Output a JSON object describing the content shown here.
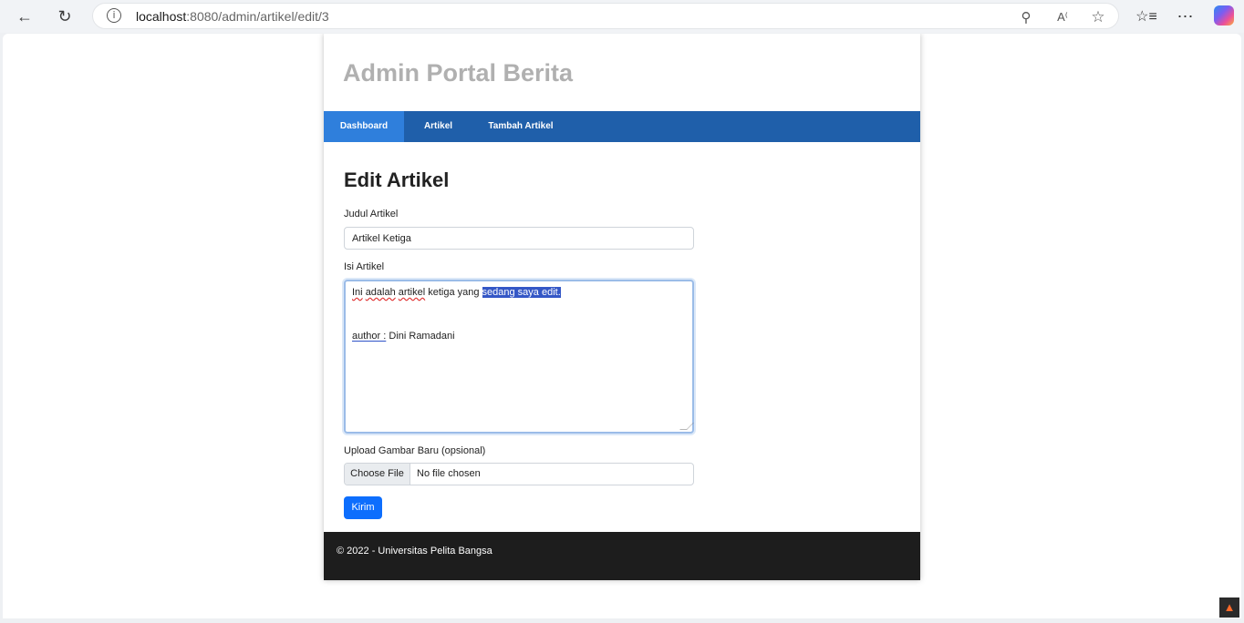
{
  "browser": {
    "url_host": "localhost",
    "url_rest": ":8080/admin/artikel/edit/3",
    "icons": {
      "back": "arrow-left-icon",
      "refresh": "refresh-icon",
      "info": "info-icon",
      "zoom": "zoom-out-icon",
      "read_aloud": "read-aloud-icon",
      "favorite": "star-icon",
      "favorites_list": "favorites-list-icon",
      "more": "more-icon",
      "copilot": "copilot-icon"
    }
  },
  "site": {
    "title": "Admin Portal Berita"
  },
  "nav": {
    "items": [
      {
        "label": "Dashboard",
        "active": true
      },
      {
        "label": "Artikel",
        "active": false
      },
      {
        "label": "Tambah Artikel",
        "active": false
      }
    ]
  },
  "main": {
    "heading": "Edit Artikel",
    "title_label": "Judul Artikel",
    "title_value": "Artikel Ketiga",
    "content_label": "Isi Artikel",
    "content": {
      "line1_words": [
        "Ini",
        "adalah",
        "artikel",
        "ketiga"
      ],
      "line1_mid": " yang ",
      "line1_selected": "sedang saya edit.",
      "line2_prefix": "author :",
      "line2_name": " Dini Ramadani"
    },
    "upload_label": "Upload Gambar Baru (opsional)",
    "file_button": "Choose File",
    "file_status": "No file chosen",
    "submit_label": "Kirim"
  },
  "footer": {
    "text": "© 2022 - Universitas Pelita Bangsa"
  },
  "colors": {
    "navbar": "#1f5faa",
    "nav_active": "#2f7fdc",
    "submit": "#0d6efd",
    "footer": "#1d1d1d",
    "selection": "#3457c6"
  }
}
